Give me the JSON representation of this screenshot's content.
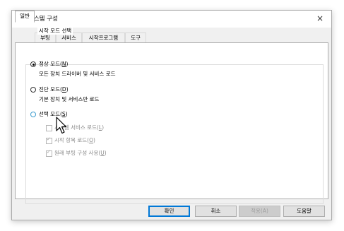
{
  "window": {
    "title": "시스템 구성",
    "close_glyph": "×"
  },
  "tabs": [
    {
      "label": "일반",
      "active": true
    },
    {
      "label": "부팅",
      "active": false
    },
    {
      "label": "서비스",
      "active": false
    },
    {
      "label": "시작프로그램",
      "active": false
    },
    {
      "label": "도구",
      "active": false
    }
  ],
  "startup_selection": {
    "legend": "시작 모드 선택",
    "normal": {
      "label": "정상 모드(",
      "key": "N",
      "suffix": ")",
      "desc": "모든 장치 드라이버 및 서비스 로드",
      "selected": true
    },
    "diagnostic": {
      "label": "진단 모드(",
      "key": "D",
      "suffix": ")",
      "desc": "기본 장치 및 서비스만 로드",
      "selected": false
    },
    "selective": {
      "label": "선택 모드(",
      "key": "S",
      "suffix": ")",
      "selected": false,
      "options": [
        {
          "label": "시스템 서비스 로드(",
          "key": "L",
          "suffix": ")",
          "checked": false
        },
        {
          "label": "시작 항목 로드(",
          "key": "O",
          "suffix": ")",
          "checked": true
        },
        {
          "label": "원래 부팅 구성 사용(",
          "key": "U",
          "suffix": ")",
          "checked": true
        }
      ]
    }
  },
  "buttons": {
    "ok": "확인",
    "cancel": "취소",
    "apply": "적용(A)",
    "help": "도움말"
  },
  "icons": {
    "title": "system-config-icon",
    "close": "close-icon",
    "cursor": "mouse-pointer-icon"
  },
  "colors": {
    "accent": "#0078d7",
    "focus": "#3c9ccf",
    "disabled_text": "#8a8a8a"
  }
}
